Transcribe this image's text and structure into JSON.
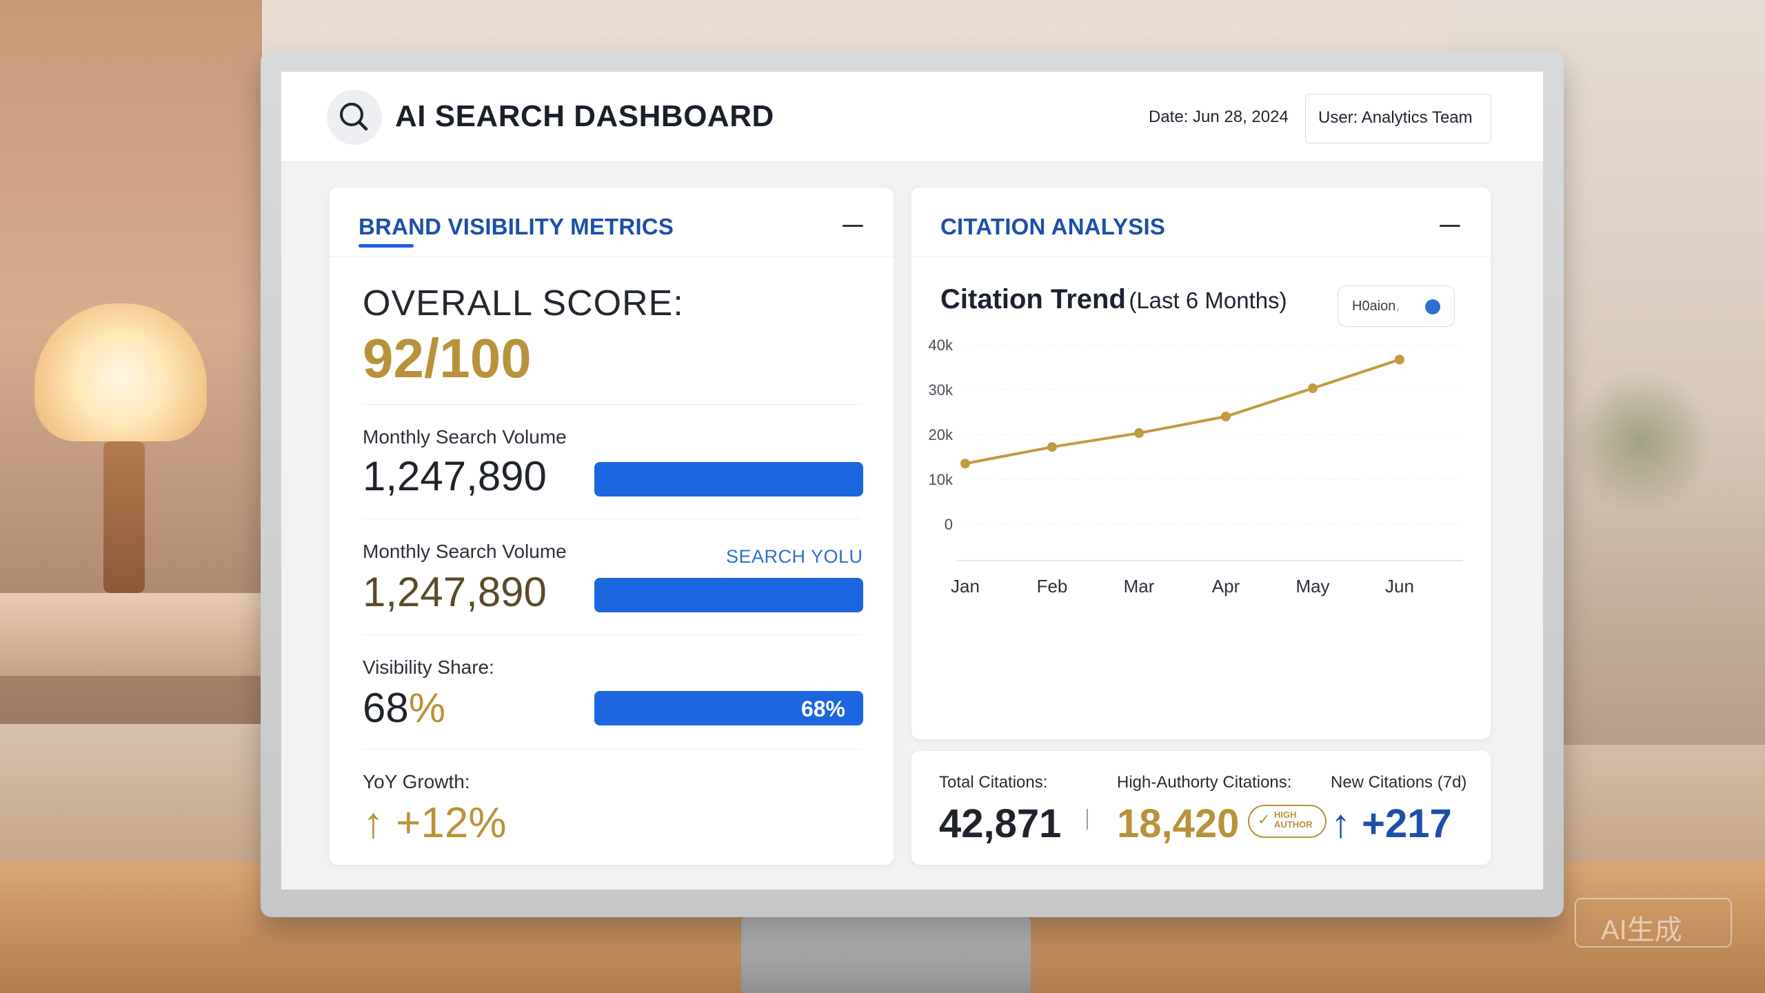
{
  "header": {
    "title": "AI SEARCH DASHBOARD",
    "date": "Date: Jun 28, 2024",
    "user": "User: Analytics Team",
    "search_icon": "search-icon"
  },
  "brand_panel": {
    "title": "BRAND VISIBILITY METRICS",
    "overall_label": "OVERALL SCORE:",
    "overall_value": "92/100",
    "metric1": {
      "label": "Monthly Search Volume",
      "value": "1,247,890"
    },
    "metric2": {
      "label": "Monthly Search Volume",
      "value": "1,247,890",
      "link": "SEARCH YOLU"
    },
    "visibility": {
      "label": "Visibility Share:",
      "value": "68",
      "unit": "%",
      "bar_label": "68%",
      "share": 0.68
    },
    "growth": {
      "label": "YoY Growth:",
      "value": "↑ +12%"
    }
  },
  "citation_panel": {
    "title": "CITATION ANALYSIS",
    "chart_title": "Citation Trend",
    "chart_subtitle": "(Last 6 Months)",
    "legend_label": "H0aion",
    "legend_mark": ",",
    "chart_data": {
      "type": "line",
      "title": "Citation Trend (Last 6 Months)",
      "categories": [
        "Jan",
        "Feb",
        "Mar",
        "Apr",
        "May",
        "Jun"
      ],
      "series": [
        {
          "name": "H0aion",
          "values": [
            13500,
            17200,
            20300,
            24000,
            30300,
            36700
          ]
        }
      ],
      "yticks": [
        "0",
        "10k",
        "20k",
        "30k",
        "40k"
      ],
      "ylim": [
        0,
        40000
      ],
      "grid": true,
      "color": "#c39a43"
    }
  },
  "stats": {
    "total": {
      "label": "Total Citations:",
      "value": "42,871"
    },
    "high": {
      "label": "High-Authorty Citations:",
      "value": "18,420",
      "badge_line1": "HIGH",
      "badge_line2": "AUTHOR"
    },
    "new": {
      "label": "New Citations (7d)",
      "value": "↑ +217"
    }
  },
  "watermark": "AI生成",
  "colors": {
    "accent_blue": "#1c66df",
    "title_blue": "#1d4fa8",
    "gold": "#b8923a"
  }
}
